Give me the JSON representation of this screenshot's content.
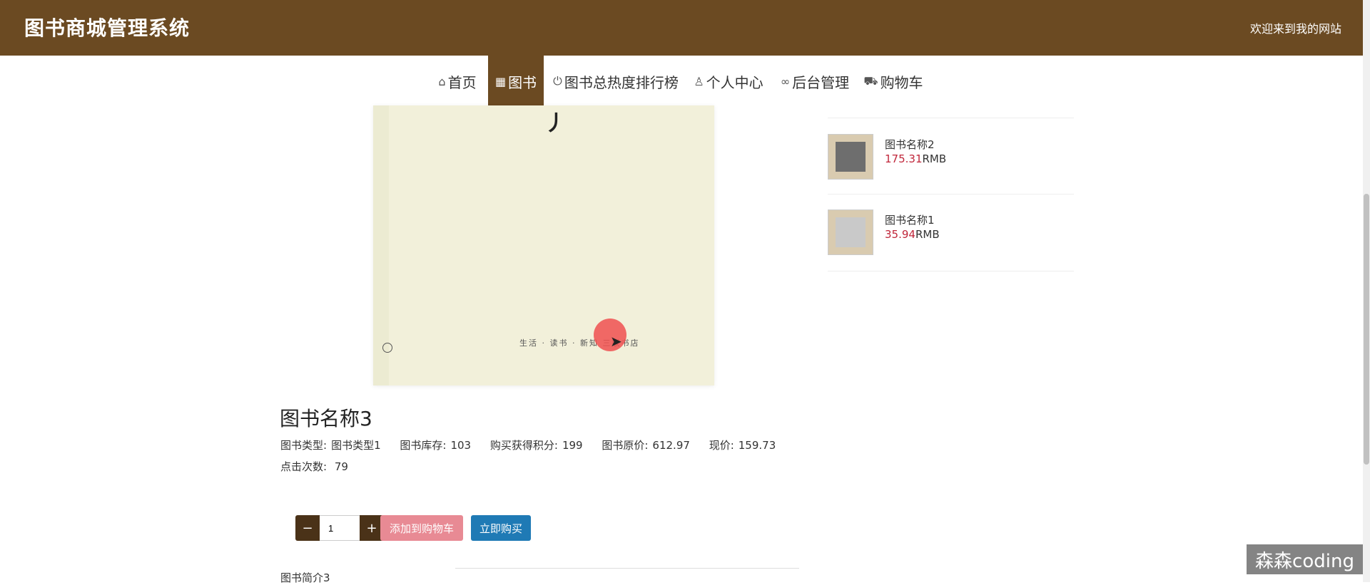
{
  "header": {
    "title": "图书商城管理系统",
    "welcome": "欢迎来到我的网站"
  },
  "nav": {
    "items": [
      {
        "icon": "home-icon",
        "label": "首页"
      },
      {
        "icon": "grid-icon",
        "label": "图书"
      },
      {
        "icon": "power-icon",
        "label": "图书总热度排行榜"
      },
      {
        "icon": "user-icon",
        "label": "个人中心"
      },
      {
        "icon": "link-icon",
        "label": "后台管理"
      },
      {
        "icon": "cart-icon",
        "label": "购物车"
      }
    ],
    "active": "图书"
  },
  "book": {
    "title": "图书名称3",
    "meta": {
      "type_label": "图书类型:",
      "type_value": "图书类型1",
      "stock_label": "图书库存:",
      "stock_value": "103",
      "points_label": "购买获得积分:",
      "points_value": "199",
      "original_label": "图书原价:",
      "original_value": "612.97",
      "price_label": "现价:",
      "price_value": "159.73",
      "clicks_label": "点击次数:",
      "clicks_value": "79"
    },
    "cover_footer_text": "生活 · 读书 · 新知 三联书店",
    "quantity": "1",
    "add_to_cart_label": "添加到购物车",
    "buy_now_label": "立即购买",
    "intro_label": "图书简介3"
  },
  "sidebar": {
    "items": [
      {
        "name": "图书名称2",
        "price": "175.31",
        "unit": "RMB"
      },
      {
        "name": "图书名称1",
        "price": "35.94",
        "unit": "RMB"
      }
    ]
  },
  "watermark": "森森coding",
  "colors": {
    "brand": "#6b4a22",
    "price": "#c0263a",
    "add_cart": "#e88a94",
    "buy": "#1f7ab5"
  }
}
